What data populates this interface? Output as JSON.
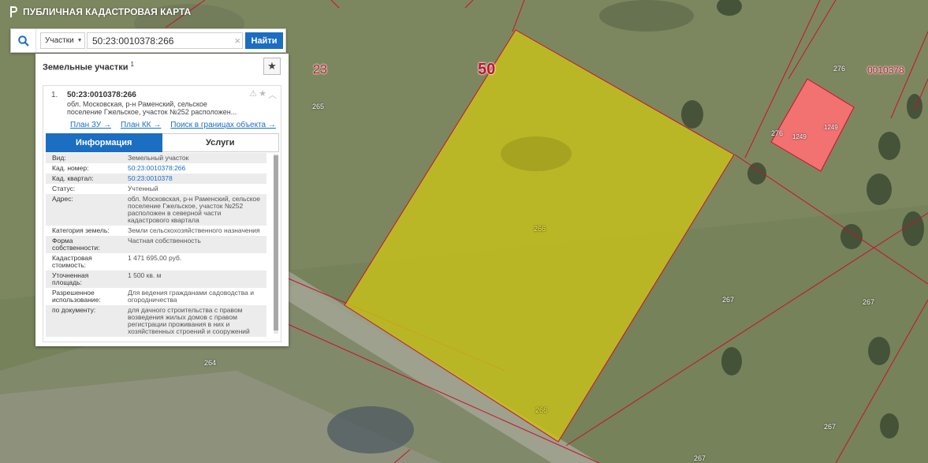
{
  "app": {
    "title": "ПУБЛИЧНАЯ КАДАСТРОВАЯ КАРТА",
    "logo_icon": "rosreestr-logo-icon"
  },
  "search": {
    "type_label": "Участки",
    "query": "50:23:0010378:266",
    "find_label": "Найти",
    "clear_glyph": "×"
  },
  "panel": {
    "title": "Земельные участки",
    "count": "1",
    "result": {
      "index": "1.",
      "cad_number": "50:23:0010378:266",
      "address_short": "обл. Московская, р-н Раменский, сельское поселение Гжельское, участок №252 расположен...",
      "links": [
        "План ЗУ →",
        "План КК →",
        "Поиск в границах объекта →"
      ]
    },
    "tabs": {
      "info": "Информация",
      "services": "Услуги"
    },
    "info_rows": [
      {
        "k": "Вид:",
        "v": "Земельный участок",
        "link": false
      },
      {
        "k": "Кад. номер:",
        "v": "50:23:0010378:266",
        "link": true
      },
      {
        "k": "Кад. квартал:",
        "v": "50:23:0010378",
        "link": true
      },
      {
        "k": "Статус:",
        "v": "Учтенный",
        "link": false
      },
      {
        "k": "Адрес:",
        "v": "обл. Московская, р-н Раменский, сельское поселение Гжельское, участок №252 расположен в северной части кадастрового квартала",
        "link": false
      },
      {
        "k": "Категория земель:",
        "v": "Земли сельскохозяйственного назначения",
        "link": false
      },
      {
        "k": "Форма собственности:",
        "v": "Частная собственность",
        "link": false
      },
      {
        "k": "Кадастровая стоимость:",
        "v": "1 471 695,00 руб.",
        "link": false
      },
      {
        "k": "Уточненная площадь:",
        "v": "1 500 кв. м",
        "link": false
      },
      {
        "k": "Разрешенное использование:",
        "v": "Для ведения гражданами садоводства и огородничества",
        "link": false
      },
      {
        "k": "по документу:",
        "v": "для дачного строительства с правом возведения жилых домов с правом регистрации проживания в них и хозяйственных строений и сооружений",
        "link": false
      }
    ]
  },
  "map": {
    "labels": {
      "region": "50",
      "district": "23",
      "quarter": "0010378",
      "p265": "265",
      "p264": "264",
      "p266a": "266",
      "p266b": "266",
      "p267a": "267",
      "p267b": "267",
      "p267c": "267",
      "p267d": "267",
      "p276a": "276",
      "p276b": "276",
      "p1249a": "1249",
      "p1249b": "1249"
    },
    "colors": {
      "selected_fill": "#c8c21a",
      "boundary": "#c8102e",
      "building_fill": "#ff6f73"
    }
  }
}
